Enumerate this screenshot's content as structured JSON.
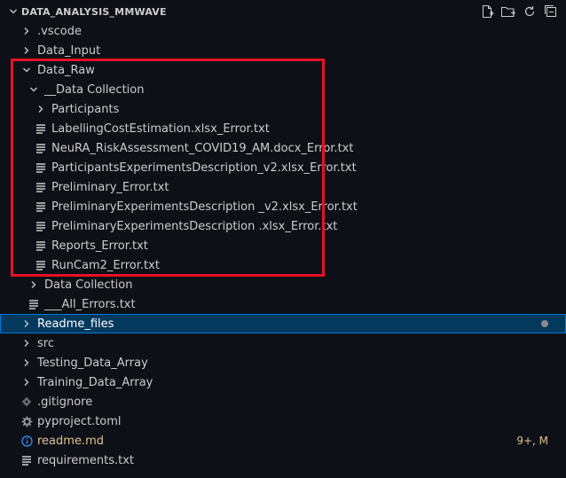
{
  "explorer": {
    "title": "DATA_ANALYSIS_MMWAVE",
    "actions": [
      {
        "name": "new-file-icon"
      },
      {
        "name": "new-folder-icon"
      },
      {
        "name": "refresh-icon"
      },
      {
        "name": "collapse-all-icon"
      }
    ]
  },
  "tree": [
    {
      "label": ".vscode",
      "type": "folder",
      "open": false,
      "indent": 1
    },
    {
      "label": "Data_Input",
      "type": "folder",
      "open": false,
      "indent": 1
    },
    {
      "label": "Data_Raw",
      "type": "folder",
      "open": true,
      "indent": 1
    },
    {
      "label": "__Data Collection",
      "type": "folder",
      "open": true,
      "indent": 2
    },
    {
      "label": "Participants",
      "type": "folder",
      "open": false,
      "indent": 3
    },
    {
      "label": "LabellingCostEstimation.xlsx_Error.txt",
      "type": "txt",
      "indent": 3
    },
    {
      "label": "NeuRA_RiskAssessment_COVID19_AM.docx_Error.txt",
      "type": "txt",
      "indent": 3
    },
    {
      "label": "ParticipantsExperimentsDescription_v2.xlsx_Error.txt",
      "type": "txt",
      "indent": 3
    },
    {
      "label": "Preliminary_Error.txt",
      "type": "txt",
      "indent": 3
    },
    {
      "label": "PreliminaryExperimentsDescription _v2.xlsx_Error.txt",
      "type": "txt",
      "indent": 3
    },
    {
      "label": "PreliminaryExperimentsDescription .xlsx_Error.txt",
      "type": "txt",
      "indent": 3
    },
    {
      "label": "Reports_Error.txt",
      "type": "txt",
      "indent": 3
    },
    {
      "label": "RunCam2_Error.txt",
      "type": "txt",
      "indent": 3
    },
    {
      "label": "Data Collection",
      "type": "folder",
      "open": false,
      "indent": 2
    },
    {
      "label": "___All_Errors.txt",
      "type": "txt",
      "indent": 2
    },
    {
      "label": "Readme_files",
      "type": "folder",
      "open": false,
      "indent": 1,
      "selected": true,
      "dot": true
    },
    {
      "label": "src",
      "type": "folder",
      "open": false,
      "indent": 1
    },
    {
      "label": "Testing_Data_Array",
      "type": "folder",
      "open": false,
      "indent": 1
    },
    {
      "label": "Training_Data_Array",
      "type": "folder",
      "open": false,
      "indent": 1
    },
    {
      "label": ".gitignore",
      "type": "gitignore",
      "indent": 1
    },
    {
      "label": "pyproject.toml",
      "type": "toml",
      "indent": 1
    },
    {
      "label": "readme.md",
      "type": "info",
      "indent": 1,
      "modified": true,
      "badge": "9+, M"
    },
    {
      "label": "requirements.txt",
      "type": "txt",
      "indent": 1
    }
  ],
  "colors": {
    "background": "#0d1117",
    "highlight": "#e81123",
    "selection": "#04395e",
    "modified": "#e2c08d",
    "info": "#3794ff"
  }
}
